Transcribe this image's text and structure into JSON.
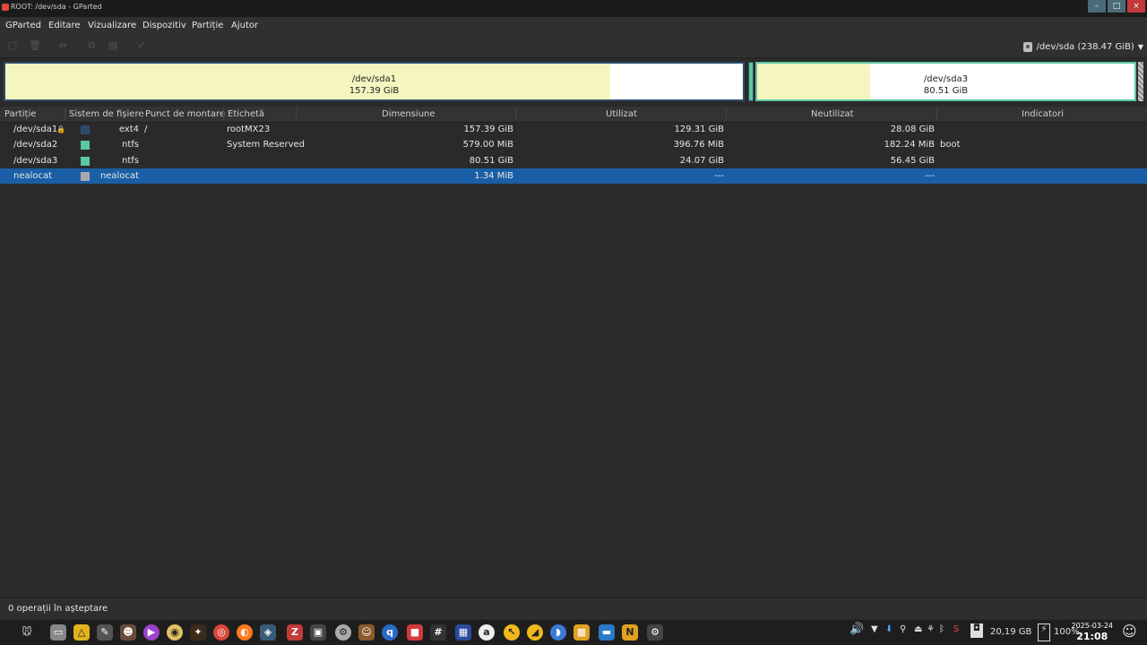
{
  "window": {
    "title": "ROOT: /dev/sda - GParted"
  },
  "menu": [
    "GParted",
    "Editare",
    "Vizualizare",
    "Dispozitiv",
    "Partiție",
    "Ajutor"
  ],
  "device_selector": {
    "label": "/dev/sda (238.47 GiB)"
  },
  "visual": [
    {
      "name": "/dev/sda1",
      "size": "157.39 GiB",
      "used_fraction": 0.82,
      "fill": "#f5f5c0",
      "border": "#2e4a6b"
    },
    {
      "name": "/dev/sda3",
      "size": "80.51 GiB",
      "used_fraction": 0.3,
      "fill": "#f5f5c0",
      "border": "#5cc7a0"
    }
  ],
  "table": {
    "headers": [
      "Partiție",
      "Sistem de fișiere",
      "Punct de montare",
      "Etichetă",
      "Dimensiune",
      "Utilizat",
      "Neutilizat",
      "Indicatori"
    ],
    "rows": [
      {
        "partition": "/dev/sda1",
        "fs": "ext4",
        "fs_color": "#2e4a6b",
        "mount": "/",
        "label": "rootMX23",
        "size": "157.39 GiB",
        "used": "129.31 GiB",
        "unused": "28.08 GiB",
        "flags": "",
        "locked": true
      },
      {
        "partition": "/dev/sda2",
        "fs": "ntfs",
        "fs_color": "#5cc7a0",
        "mount": "",
        "label": "System Reserved",
        "size": "579.00 MiB",
        "used": "396.76 MiB",
        "unused": "182.24 MiB",
        "flags": "boot"
      },
      {
        "partition": "/dev/sda3",
        "fs": "ntfs",
        "fs_color": "#5cc7a0",
        "mount": "",
        "label": "",
        "size": "80.51 GiB",
        "used": "24.07 GiB",
        "unused": "56.45 GiB",
        "flags": ""
      },
      {
        "partition": "nealocat",
        "fs": "nealocat",
        "fs_color": "#a8a8a8",
        "mount": "",
        "label": "",
        "size": "1.34 MiB",
        "used": "---",
        "unused": "---",
        "flags": "",
        "selected": true
      }
    ]
  },
  "status": {
    "text": "0 operații în așteptare"
  },
  "taskbar": {
    "disk_free": "20,19 GB",
    "battery": "100%",
    "date": "2025-03-24",
    "time": "21:08"
  },
  "colors": {
    "selection": "#1a5fa6",
    "background": "#2a2a2a"
  }
}
